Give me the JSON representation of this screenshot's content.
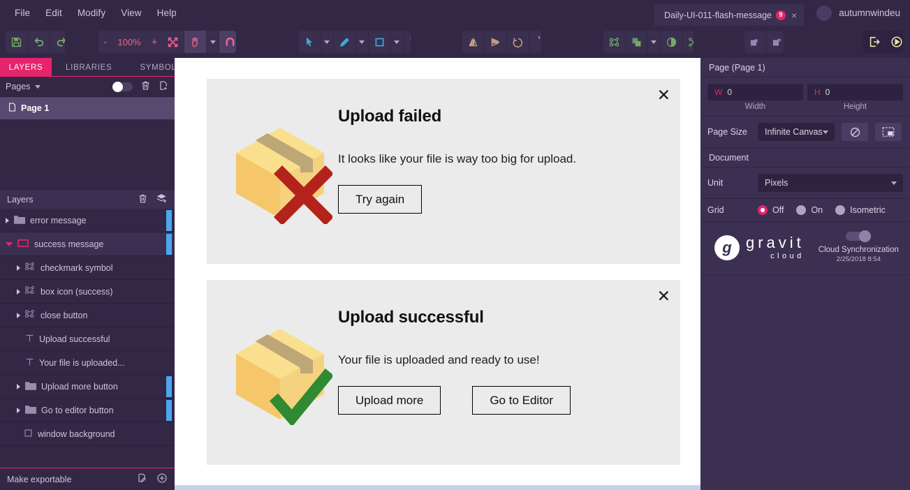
{
  "menu": {
    "items": [
      "File",
      "Edit",
      "Modify",
      "View",
      "Help"
    ]
  },
  "titlebar": {
    "document_tab": "Daily-UI-011-flash-message",
    "document_tab_badge": "9",
    "close_glyph": "×",
    "account_name": "autumnwindeu"
  },
  "toolbar": {
    "zoom_minus": "-",
    "zoom_value": "100%",
    "zoom_plus": "+",
    "icons": {
      "save": "save-icon",
      "undo": "undo-icon",
      "redo": "redo-icon",
      "fit": "fit-to-screen-icon",
      "hand": "hand-tool-icon",
      "snap": "magnet-snap-icon",
      "select": "select-arrow-icon",
      "pen": "pen-tool-icon",
      "rect": "rectangle-tool-icon",
      "text": "text-tool-icon",
      "flip_h": "flip-horizontal-icon",
      "flip_v": "flip-vertical-icon",
      "rotate_ccw": "rotate-left-icon",
      "rotate_cw": "rotate-right-icon",
      "transform": "transform-nodes-icon",
      "boolean": "boolean-union-icon",
      "contrast": "contrast-icon",
      "path_nodes": "path-nodes-icon",
      "group": "group-icon",
      "ungroup": "ungroup-icon",
      "export": "export-icon",
      "preview": "preview-play-icon"
    }
  },
  "left_panel": {
    "tabs": [
      {
        "label": "LAYERS",
        "selected": true
      },
      {
        "label": "LIBRARIES",
        "selected": false
      },
      {
        "label": "SYMBOLS",
        "selected": false
      }
    ],
    "pages_label": "Pages",
    "pages": [
      {
        "label": "Page 1",
        "selected": true
      }
    ],
    "layers_label": "Layers",
    "layers": [
      {
        "label": "error message",
        "indent": 0,
        "type": "folder",
        "disclosure": "closed",
        "marker": true,
        "selected": false
      },
      {
        "label": "success message",
        "indent": 0,
        "type": "folder-open",
        "disclosure": "open",
        "marker": true,
        "selected": true
      },
      {
        "label": "checkmark symbol",
        "indent": 1,
        "type": "symbol",
        "disclosure": "closed",
        "marker": false,
        "selected": false
      },
      {
        "label": "box icon (success)",
        "indent": 1,
        "type": "symbol",
        "disclosure": "closed",
        "marker": false,
        "selected": false
      },
      {
        "label": "close button",
        "indent": 1,
        "type": "symbol",
        "disclosure": "closed",
        "marker": false,
        "selected": false
      },
      {
        "label": "Upload successful",
        "indent": 1,
        "type": "text",
        "disclosure": "none",
        "marker": false,
        "selected": false
      },
      {
        "label": "Your file is uploaded...",
        "indent": 1,
        "type": "text",
        "disclosure": "none",
        "marker": false,
        "selected": false
      },
      {
        "label": "Upload more button",
        "indent": 1,
        "type": "folder",
        "disclosure": "closed",
        "marker": true,
        "selected": false
      },
      {
        "label": "Go to editor button",
        "indent": 1,
        "type": "folder",
        "disclosure": "closed",
        "marker": true,
        "selected": false
      },
      {
        "label": "window background",
        "indent": 1,
        "type": "rect",
        "disclosure": "none",
        "marker": false,
        "selected": false
      }
    ],
    "make_exportable": "Make exportable"
  },
  "right_panel": {
    "page_title": "Page (Page 1)",
    "width_key": "W",
    "width_value": "0",
    "width_label": "Width",
    "height_key": "H",
    "height_value": "0",
    "height_label": "Height",
    "page_size_label": "Page Size",
    "page_size_value": "Infinite Canvas",
    "document_label": "Document",
    "unit_label": "Unit",
    "unit_value": "Pixels",
    "grid_label": "Grid",
    "grid_options": [
      {
        "label": "Off",
        "selected": true
      },
      {
        "label": "On",
        "selected": false
      },
      {
        "label": "Isometric",
        "selected": false
      }
    ],
    "brand_mark": "g",
    "brand_line1": "gravit",
    "brand_line2": "cloud",
    "sync_label": "Cloud Synchronization",
    "sync_time": "2/25/2018 8:54"
  },
  "canvas": {
    "cards": [
      {
        "id": "error",
        "title": "Upload failed",
        "message": "It looks like your file is way too big for upload.",
        "close_glyph": "✕",
        "buttons": [
          "Try again"
        ],
        "art": "package-box-with-red-x"
      },
      {
        "id": "success",
        "title": "Upload successful",
        "message": "Your file is uploaded and ready to use!",
        "close_glyph": "✕",
        "buttons": [
          "Upload more",
          "Go to Editor"
        ],
        "art": "package-box-with-green-check"
      }
    ],
    "colors": {
      "card_bg": "#ebebeb",
      "canvas_bg": "#ffffff",
      "box_front": "#f6c66a",
      "box_top": "#fadf8e",
      "box_side": "#f5d27e",
      "tape": "#bda777",
      "error_mark": "#b4231b",
      "success_mark": "#2f8a31"
    }
  },
  "theme": {
    "accent_pink": "#e5246b",
    "bg_dark": "#332746",
    "panel_dark": "#3c3052",
    "marker_blue": "#4da6f0"
  }
}
